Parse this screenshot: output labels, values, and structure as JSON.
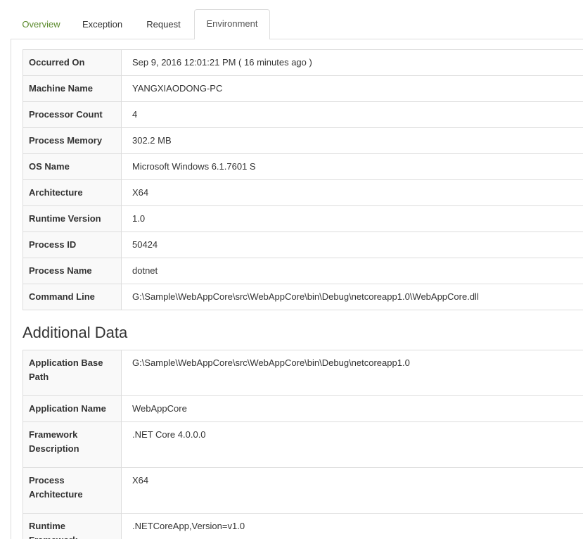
{
  "tabs": [
    {
      "label": "Overview",
      "active": false
    },
    {
      "label": "Exception",
      "active": false
    },
    {
      "label": "Request",
      "active": false
    },
    {
      "label": "Environment",
      "active": true
    }
  ],
  "environment": {
    "rows": [
      {
        "key": "Occurred On",
        "value": "Sep 9, 2016 12:01:21 PM ( 16 minutes ago )"
      },
      {
        "key": "Machine Name",
        "value": "YANGXIAODONG-PC"
      },
      {
        "key": "Processor Count",
        "value": "4"
      },
      {
        "key": "Process Memory",
        "value": "302.2 MB"
      },
      {
        "key": "OS Name",
        "value": "Microsoft Windows 6.1.7601 S"
      },
      {
        "key": "Architecture",
        "value": "X64"
      },
      {
        "key": "Runtime Version",
        "value": "1.0"
      },
      {
        "key": "Process ID",
        "value": "50424"
      },
      {
        "key": "Process Name",
        "value": "dotnet"
      },
      {
        "key": "Command Line",
        "value": "G:\\Sample\\WebAppCore\\src\\WebAppCore\\bin\\Debug\\netcoreapp1.0\\WebAppCore.dll"
      }
    ]
  },
  "additional": {
    "title": "Additional Data",
    "rows": [
      {
        "key": "Application Base Path",
        "value": "G:\\Sample\\WebAppCore\\src\\WebAppCore\\bin\\Debug\\netcoreapp1.0"
      },
      {
        "key": "Application Name",
        "value": "WebAppCore"
      },
      {
        "key": "Framework Description",
        "value": ".NET Core 4.0.0.0"
      },
      {
        "key": "Process Architecture",
        "value": "X64"
      },
      {
        "key": "Runtime Framework",
        "value": ".NETCoreApp,Version=v1.0"
      }
    ]
  }
}
